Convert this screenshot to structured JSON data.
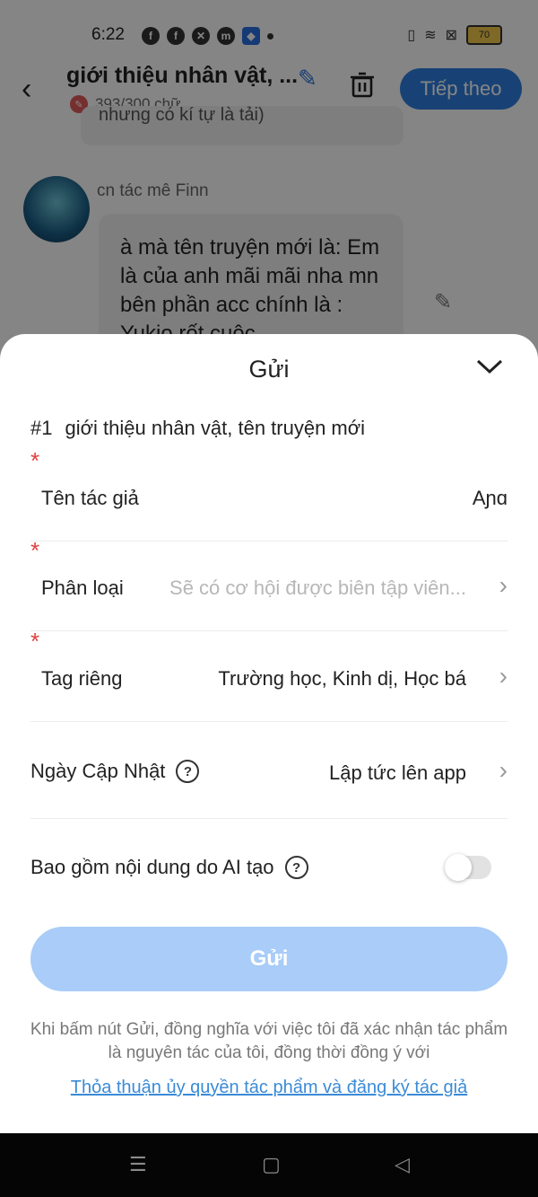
{
  "status_bar": {
    "time": "6:22",
    "battery": "70"
  },
  "header": {
    "title": "giới thiệu nhân vật, ...",
    "word_count": "393/300 chữ",
    "next_button": "Tiếp theo"
  },
  "background_chat": {
    "prev_snippet": "nhưng có kí tự là tải)",
    "author": "cn tác mê Finn",
    "message": "à mà tên truyện mới là: Em là của anh mãi mãi nha mn bên phần acc chính là : Yukio rốt cuộc"
  },
  "sheet": {
    "title": "Gửi",
    "chapter_no": "#1",
    "chapter_title": "giới thiệu nhân vật, tên truyện mới",
    "rows": [
      {
        "label": "Tên tác giả",
        "value": "Aɲɑ",
        "required": "*"
      },
      {
        "label": "Phân loại",
        "value": "Sẽ có cơ hội được biên tập viên...",
        "required": "*"
      },
      {
        "label": "Tag riêng",
        "value": "Trường học, Kinh dị, Học bá",
        "required": "*"
      },
      {
        "label": "Ngày Cập Nhật",
        "value": "Lập tức lên app"
      },
      {
        "label": "Bao gồm nội dung do AI tạo"
      }
    ],
    "ai_toggle_on": false,
    "send_button": "Gửi",
    "disclaimer_line1": "Khi bấm nút Gửi, đồng nghĩa với việc tôi đã xác nhận tác phẩm",
    "disclaimer_line2": "là nguyên tác của tôi, đồng thời đồng ý với",
    "agreement_link": "Thỏa thuận ủy quyền tác phẩm và đăng ký tác giả"
  }
}
